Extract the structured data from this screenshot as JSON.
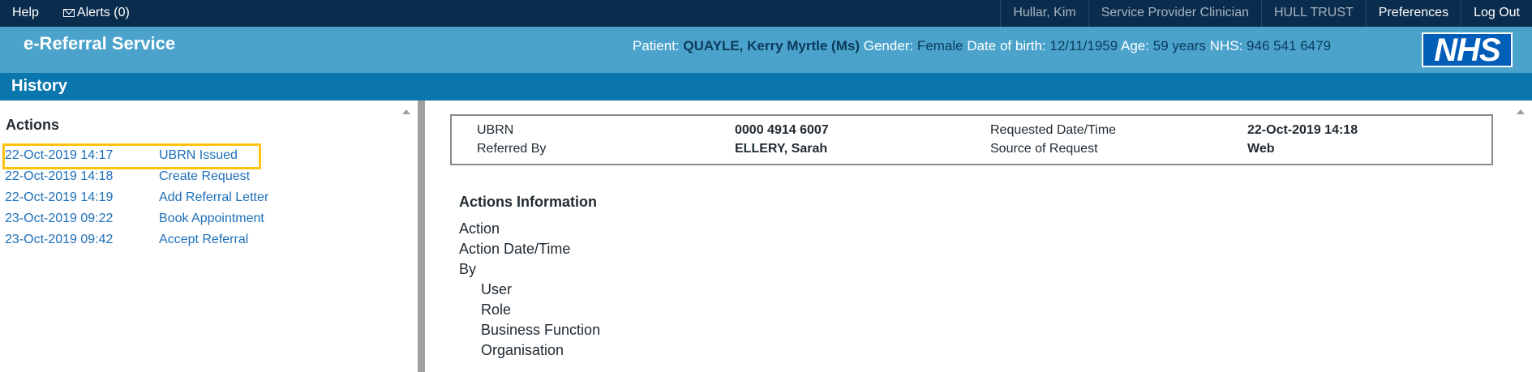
{
  "topbar": {
    "help": "Help",
    "alerts": "Alerts (0)",
    "user": "Hullar, Kim",
    "role": "Service Provider Clinician",
    "organisation": "HULL TRUST",
    "preferences": "Preferences",
    "logout": "Log Out"
  },
  "header": {
    "app_title": "e-Referral Service",
    "patient_label": "Patient:",
    "patient_name": "QUAYLE, Kerry Myrtle (Ms)",
    "gender_label": "Gender:",
    "gender": "Female",
    "dob_label": "Date of birth:",
    "dob": "12/11/1959",
    "age_label": "Age:",
    "age": "59 years",
    "nhs_label": "NHS:",
    "nhs_number": "946 541 6479",
    "logo": "NHS"
  },
  "page_title": "History",
  "actions": {
    "title": "Actions",
    "items": [
      {
        "date": "22-Oct-2019 14:17",
        "label": "UBRN Issued"
      },
      {
        "date": "22-Oct-2019 14:18",
        "label": "Create Request"
      },
      {
        "date": "22-Oct-2019 14:19",
        "label": "Add Referral Letter"
      },
      {
        "date": "23-Oct-2019 09:22",
        "label": "Book Appointment"
      },
      {
        "date": "23-Oct-2019 09:42",
        "label": "Accept Referral"
      }
    ]
  },
  "summary": {
    "ubrn_label": "UBRN",
    "ubrn": "0000 4914 6007",
    "requested_label": "Requested Date/Time",
    "requested": "22-Oct-2019 14:18",
    "referred_by_label": "Referred By",
    "referred_by": "ELLERY, Sarah",
    "source_label": "Source of Request",
    "source": "Web"
  },
  "info": {
    "title": "Actions Information",
    "action": "Action",
    "action_datetime": "Action Date/Time",
    "by": "By",
    "user": "User",
    "role": "Role",
    "business_function": "Business Function",
    "organisation": "Organisation"
  },
  "colors": {
    "topbar": "#0b2d4d",
    "header": "#4ba3cc",
    "pagebar": "#0a76ad",
    "link": "#1d6fb8",
    "highlight": "#ffc20e"
  }
}
